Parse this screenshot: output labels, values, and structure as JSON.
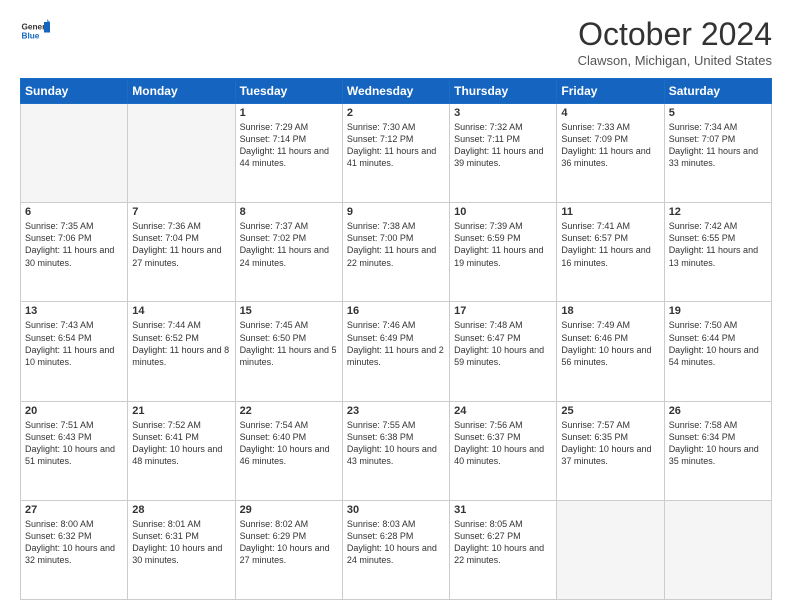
{
  "header": {
    "logo_general": "General",
    "logo_blue": "Blue",
    "title": "October 2024",
    "location": "Clawson, Michigan, United States"
  },
  "days_of_week": [
    "Sunday",
    "Monday",
    "Tuesday",
    "Wednesday",
    "Thursday",
    "Friday",
    "Saturday"
  ],
  "weeks": [
    [
      {
        "day": "",
        "sunrise": "",
        "sunset": "",
        "daylight": ""
      },
      {
        "day": "",
        "sunrise": "",
        "sunset": "",
        "daylight": ""
      },
      {
        "day": "1",
        "sunrise": "Sunrise: 7:29 AM",
        "sunset": "Sunset: 7:14 PM",
        "daylight": "Daylight: 11 hours and 44 minutes."
      },
      {
        "day": "2",
        "sunrise": "Sunrise: 7:30 AM",
        "sunset": "Sunset: 7:12 PM",
        "daylight": "Daylight: 11 hours and 41 minutes."
      },
      {
        "day": "3",
        "sunrise": "Sunrise: 7:32 AM",
        "sunset": "Sunset: 7:11 PM",
        "daylight": "Daylight: 11 hours and 39 minutes."
      },
      {
        "day": "4",
        "sunrise": "Sunrise: 7:33 AM",
        "sunset": "Sunset: 7:09 PM",
        "daylight": "Daylight: 11 hours and 36 minutes."
      },
      {
        "day": "5",
        "sunrise": "Sunrise: 7:34 AM",
        "sunset": "Sunset: 7:07 PM",
        "daylight": "Daylight: 11 hours and 33 minutes."
      }
    ],
    [
      {
        "day": "6",
        "sunrise": "Sunrise: 7:35 AM",
        "sunset": "Sunset: 7:06 PM",
        "daylight": "Daylight: 11 hours and 30 minutes."
      },
      {
        "day": "7",
        "sunrise": "Sunrise: 7:36 AM",
        "sunset": "Sunset: 7:04 PM",
        "daylight": "Daylight: 11 hours and 27 minutes."
      },
      {
        "day": "8",
        "sunrise": "Sunrise: 7:37 AM",
        "sunset": "Sunset: 7:02 PM",
        "daylight": "Daylight: 11 hours and 24 minutes."
      },
      {
        "day": "9",
        "sunrise": "Sunrise: 7:38 AM",
        "sunset": "Sunset: 7:00 PM",
        "daylight": "Daylight: 11 hours and 22 minutes."
      },
      {
        "day": "10",
        "sunrise": "Sunrise: 7:39 AM",
        "sunset": "Sunset: 6:59 PM",
        "daylight": "Daylight: 11 hours and 19 minutes."
      },
      {
        "day": "11",
        "sunrise": "Sunrise: 7:41 AM",
        "sunset": "Sunset: 6:57 PM",
        "daylight": "Daylight: 11 hours and 16 minutes."
      },
      {
        "day": "12",
        "sunrise": "Sunrise: 7:42 AM",
        "sunset": "Sunset: 6:55 PM",
        "daylight": "Daylight: 11 hours and 13 minutes."
      }
    ],
    [
      {
        "day": "13",
        "sunrise": "Sunrise: 7:43 AM",
        "sunset": "Sunset: 6:54 PM",
        "daylight": "Daylight: 11 hours and 10 minutes."
      },
      {
        "day": "14",
        "sunrise": "Sunrise: 7:44 AM",
        "sunset": "Sunset: 6:52 PM",
        "daylight": "Daylight: 11 hours and 8 minutes."
      },
      {
        "day": "15",
        "sunrise": "Sunrise: 7:45 AM",
        "sunset": "Sunset: 6:50 PM",
        "daylight": "Daylight: 11 hours and 5 minutes."
      },
      {
        "day": "16",
        "sunrise": "Sunrise: 7:46 AM",
        "sunset": "Sunset: 6:49 PM",
        "daylight": "Daylight: 11 hours and 2 minutes."
      },
      {
        "day": "17",
        "sunrise": "Sunrise: 7:48 AM",
        "sunset": "Sunset: 6:47 PM",
        "daylight": "Daylight: 10 hours and 59 minutes."
      },
      {
        "day": "18",
        "sunrise": "Sunrise: 7:49 AM",
        "sunset": "Sunset: 6:46 PM",
        "daylight": "Daylight: 10 hours and 56 minutes."
      },
      {
        "day": "19",
        "sunrise": "Sunrise: 7:50 AM",
        "sunset": "Sunset: 6:44 PM",
        "daylight": "Daylight: 10 hours and 54 minutes."
      }
    ],
    [
      {
        "day": "20",
        "sunrise": "Sunrise: 7:51 AM",
        "sunset": "Sunset: 6:43 PM",
        "daylight": "Daylight: 10 hours and 51 minutes."
      },
      {
        "day": "21",
        "sunrise": "Sunrise: 7:52 AM",
        "sunset": "Sunset: 6:41 PM",
        "daylight": "Daylight: 10 hours and 48 minutes."
      },
      {
        "day": "22",
        "sunrise": "Sunrise: 7:54 AM",
        "sunset": "Sunset: 6:40 PM",
        "daylight": "Daylight: 10 hours and 46 minutes."
      },
      {
        "day": "23",
        "sunrise": "Sunrise: 7:55 AM",
        "sunset": "Sunset: 6:38 PM",
        "daylight": "Daylight: 10 hours and 43 minutes."
      },
      {
        "day": "24",
        "sunrise": "Sunrise: 7:56 AM",
        "sunset": "Sunset: 6:37 PM",
        "daylight": "Daylight: 10 hours and 40 minutes."
      },
      {
        "day": "25",
        "sunrise": "Sunrise: 7:57 AM",
        "sunset": "Sunset: 6:35 PM",
        "daylight": "Daylight: 10 hours and 37 minutes."
      },
      {
        "day": "26",
        "sunrise": "Sunrise: 7:58 AM",
        "sunset": "Sunset: 6:34 PM",
        "daylight": "Daylight: 10 hours and 35 minutes."
      }
    ],
    [
      {
        "day": "27",
        "sunrise": "Sunrise: 8:00 AM",
        "sunset": "Sunset: 6:32 PM",
        "daylight": "Daylight: 10 hours and 32 minutes."
      },
      {
        "day": "28",
        "sunrise": "Sunrise: 8:01 AM",
        "sunset": "Sunset: 6:31 PM",
        "daylight": "Daylight: 10 hours and 30 minutes."
      },
      {
        "day": "29",
        "sunrise": "Sunrise: 8:02 AM",
        "sunset": "Sunset: 6:29 PM",
        "daylight": "Daylight: 10 hours and 27 minutes."
      },
      {
        "day": "30",
        "sunrise": "Sunrise: 8:03 AM",
        "sunset": "Sunset: 6:28 PM",
        "daylight": "Daylight: 10 hours and 24 minutes."
      },
      {
        "day": "31",
        "sunrise": "Sunrise: 8:05 AM",
        "sunset": "Sunset: 6:27 PM",
        "daylight": "Daylight: 10 hours and 22 minutes."
      },
      {
        "day": "",
        "sunrise": "",
        "sunset": "",
        "daylight": ""
      },
      {
        "day": "",
        "sunrise": "",
        "sunset": "",
        "daylight": ""
      }
    ]
  ]
}
